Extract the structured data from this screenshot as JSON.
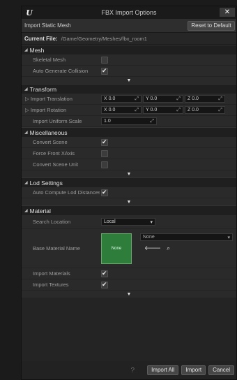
{
  "window": {
    "title": "FBX Import Options",
    "close_label": "✕"
  },
  "header": {
    "import_type": "Import Static Mesh",
    "reset_label": "Reset to Default",
    "current_file_label": "Current File:",
    "current_file_path": "/Game/Geometry/Meshes/fbx_room1"
  },
  "mesh": {
    "title": "Mesh",
    "skeletal_mesh": {
      "label": "Skeletal Mesh",
      "checked": false
    },
    "auto_collision": {
      "label": "Auto Generate Collision",
      "checked": true
    }
  },
  "transform": {
    "title": "Transform",
    "translation": {
      "label": "Import Translation",
      "x": "X 0.0",
      "y": "Y 0.0",
      "z": "Z 0.0"
    },
    "rotation": {
      "label": "Import Rotation",
      "x": "X 0.0",
      "y": "Y 0.0",
      "z": "Z 0.0"
    },
    "uniform_scale": {
      "label": "Import Uniform Scale",
      "value": "1.0"
    }
  },
  "misc": {
    "title": "Miscellaneous",
    "convert_scene": {
      "label": "Convert Scene",
      "checked": true
    },
    "force_front_xaxis": {
      "label": "Force Front XAxis",
      "checked": false
    },
    "convert_scene_unit": {
      "label": "Convert Scene Unit",
      "checked": false
    }
  },
  "lod": {
    "title": "Lod Settings",
    "auto_compute": {
      "label": "Auto Compute Lod Distances",
      "checked": true
    }
  },
  "material": {
    "title": "Material",
    "search_location": {
      "label": "Search Location",
      "value": "Local"
    },
    "base_material": {
      "label": "Base Material Name",
      "thumb": "None",
      "value": "None"
    },
    "import_materials": {
      "label": "Import Materials",
      "checked": true
    },
    "import_textures": {
      "label": "Import Textures",
      "checked": true
    }
  },
  "footer": {
    "import_all_label": "Import All",
    "import_label": "Import",
    "cancel_label": "Cancel"
  }
}
